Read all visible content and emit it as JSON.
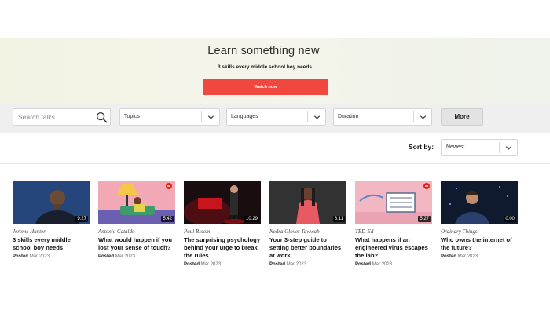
{
  "hero": {
    "title": "Learn something new",
    "subtitle": "3 skills every middle school boy needs",
    "cta": "Watch now"
  },
  "filters": {
    "search_placeholder": "Search talks...",
    "topics": "Topics",
    "languages": "Languages",
    "duration": "Duration",
    "more": "More"
  },
  "sort": {
    "label": "Sort by:",
    "value": "Newest"
  },
  "talks": [
    {
      "author": "Jerome Hunter",
      "title": "3 skills every middle school boy needs",
      "posted_label": "Posted",
      "date": "Mar 2023",
      "duration": "9:27"
    },
    {
      "author": "Antonio Cataldo",
      "title": "What would happen if you lost your sense of touch?",
      "posted_label": "Posted",
      "date": "Mar 2023",
      "duration": "5:42"
    },
    {
      "author": "Paul Bloom",
      "title": "The surprising psychology behind your urge to break the rules",
      "posted_label": "Posted",
      "date": "Mar 2023",
      "duration": "10:29"
    },
    {
      "author": "Nedra Glover Tawwab",
      "title": "Your 3-step guide to setting better boundaries at work",
      "posted_label": "Posted",
      "date": "Mar 2023",
      "duration": "6:11"
    },
    {
      "author": "TED-Ed",
      "title": "What happens if an engineered virus escapes the lab?",
      "posted_label": "Posted",
      "date": "Mar 2023",
      "duration": "5:27"
    },
    {
      "author": "Ordinary Things",
      "title": "Who owns the internet of the future?",
      "posted_label": "Posted",
      "date": "Mar 2023",
      "duration": "0:00"
    }
  ],
  "colors": {
    "accent": "#f0483e",
    "filter_bar": "#efefef"
  },
  "icons": [
    "search-icon",
    "chevron-down-icon"
  ]
}
